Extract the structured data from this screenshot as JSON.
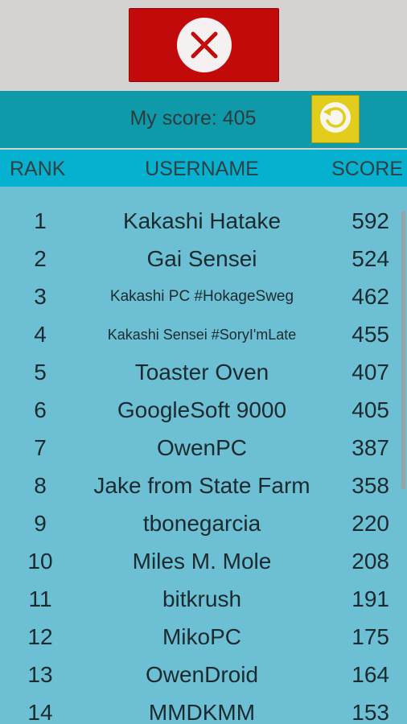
{
  "colors": {
    "close": "#c20a0a",
    "scorebar": "#0e9aa8",
    "header": "#05b1cf",
    "list": "#6dc0d4",
    "refresh": "#e2cd1c"
  },
  "icons": {
    "close": "close-icon",
    "refresh": "refresh-icon"
  },
  "score_bar": {
    "label": "My score: 405"
  },
  "table": {
    "headers": {
      "rank": "RANK",
      "username": "USERNAME",
      "score": "SCORE"
    },
    "rows": [
      {
        "rank": "1",
        "username": "Kakashi Hatake",
        "score": "592"
      },
      {
        "rank": "2",
        "username": "Gai Sensei",
        "score": "524"
      },
      {
        "rank": "3",
        "username": "Kakashi PC #HokageSweg",
        "score": "462"
      },
      {
        "rank": "4",
        "username": "Kakashi Sensei #SoryI'mLate",
        "score": "455"
      },
      {
        "rank": "5",
        "username": "Toaster Oven",
        "score": "407"
      },
      {
        "rank": "6",
        "username": "GoogleSoft 9000",
        "score": "405"
      },
      {
        "rank": "7",
        "username": "OwenPC",
        "score": "387"
      },
      {
        "rank": "8",
        "username": "Jake from State Farm",
        "score": "358"
      },
      {
        "rank": "9",
        "username": "tbonegarcia",
        "score": "220"
      },
      {
        "rank": "10",
        "username": "Miles M. Mole",
        "score": "208"
      },
      {
        "rank": "11",
        "username": "bitkrush",
        "score": "191"
      },
      {
        "rank": "12",
        "username": "MikoPC",
        "score": "175"
      },
      {
        "rank": "13",
        "username": "OwenDroid",
        "score": "164"
      },
      {
        "rank": "14",
        "username": "MMDKMM",
        "score": "153"
      }
    ]
  }
}
